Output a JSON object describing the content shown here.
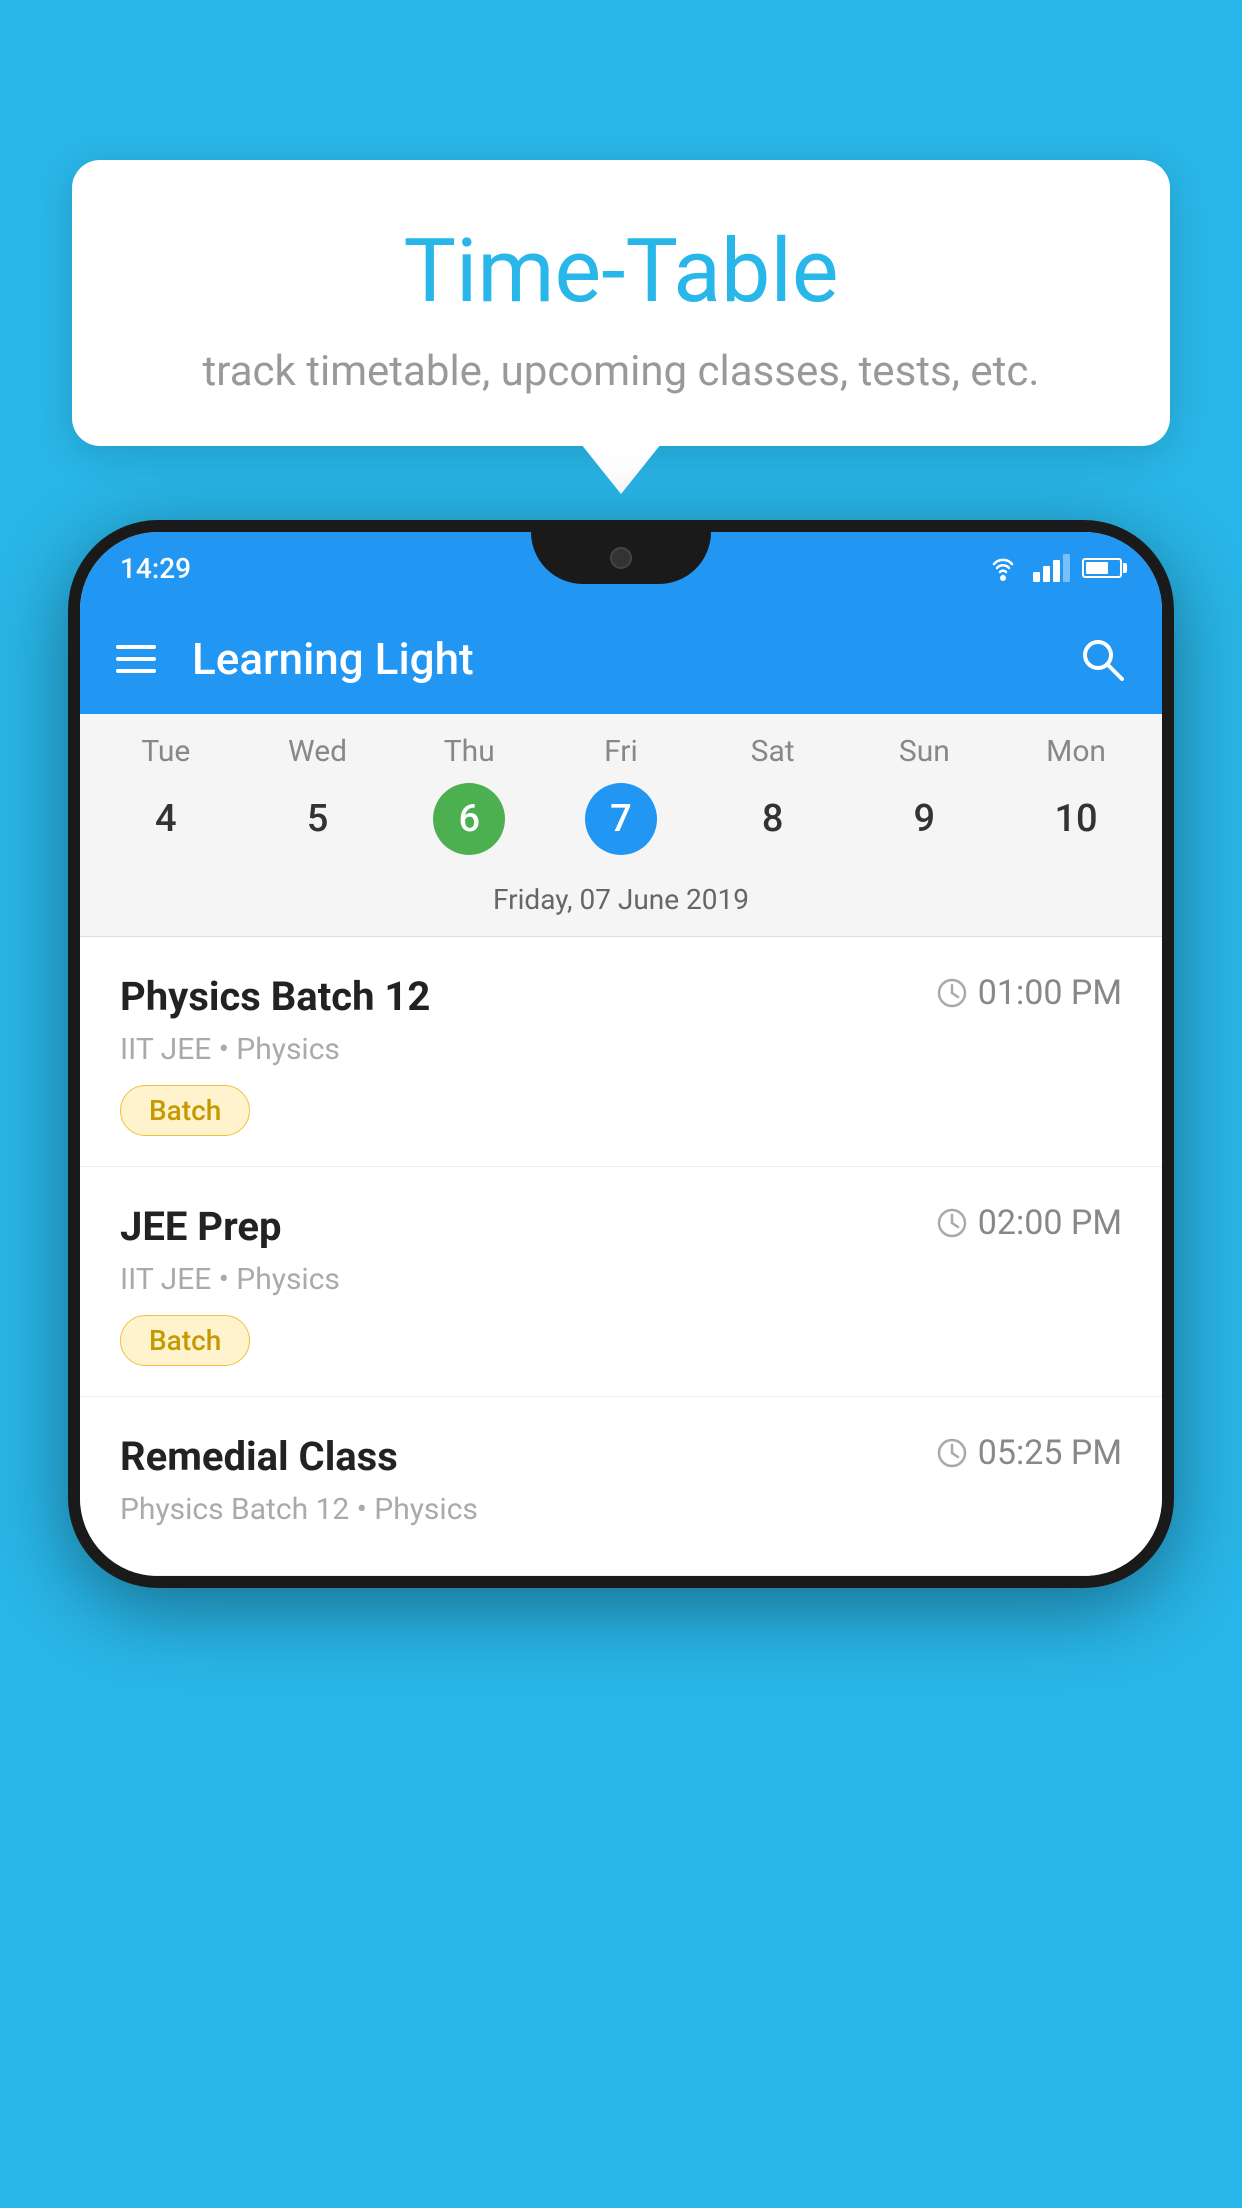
{
  "background_color": "#29b6e8",
  "tooltip": {
    "title": "Time-Table",
    "subtitle": "track timetable, upcoming classes, tests, etc."
  },
  "phone": {
    "status_bar": {
      "time": "14:29"
    },
    "app_bar": {
      "title": "Learning Light"
    },
    "calendar": {
      "days": [
        {
          "name": "Tue",
          "number": "4",
          "state": "normal"
        },
        {
          "name": "Wed",
          "number": "5",
          "state": "normal"
        },
        {
          "name": "Thu",
          "number": "6",
          "state": "today"
        },
        {
          "name": "Fri",
          "number": "7",
          "state": "selected"
        },
        {
          "name": "Sat",
          "number": "8",
          "state": "normal"
        },
        {
          "name": "Sun",
          "number": "9",
          "state": "normal"
        },
        {
          "name": "Mon",
          "number": "10",
          "state": "normal"
        }
      ],
      "selected_date_label": "Friday, 07 June 2019"
    },
    "schedule": [
      {
        "title": "Physics Batch 12",
        "time": "01:00 PM",
        "meta": "IIT JEE • Physics",
        "tag": "Batch"
      },
      {
        "title": "JEE Prep",
        "time": "02:00 PM",
        "meta": "IIT JEE • Physics",
        "tag": "Batch"
      },
      {
        "title": "Remedial Class",
        "time": "05:25 PM",
        "meta": "Physics Batch 12 • Physics",
        "tag": null
      }
    ]
  }
}
